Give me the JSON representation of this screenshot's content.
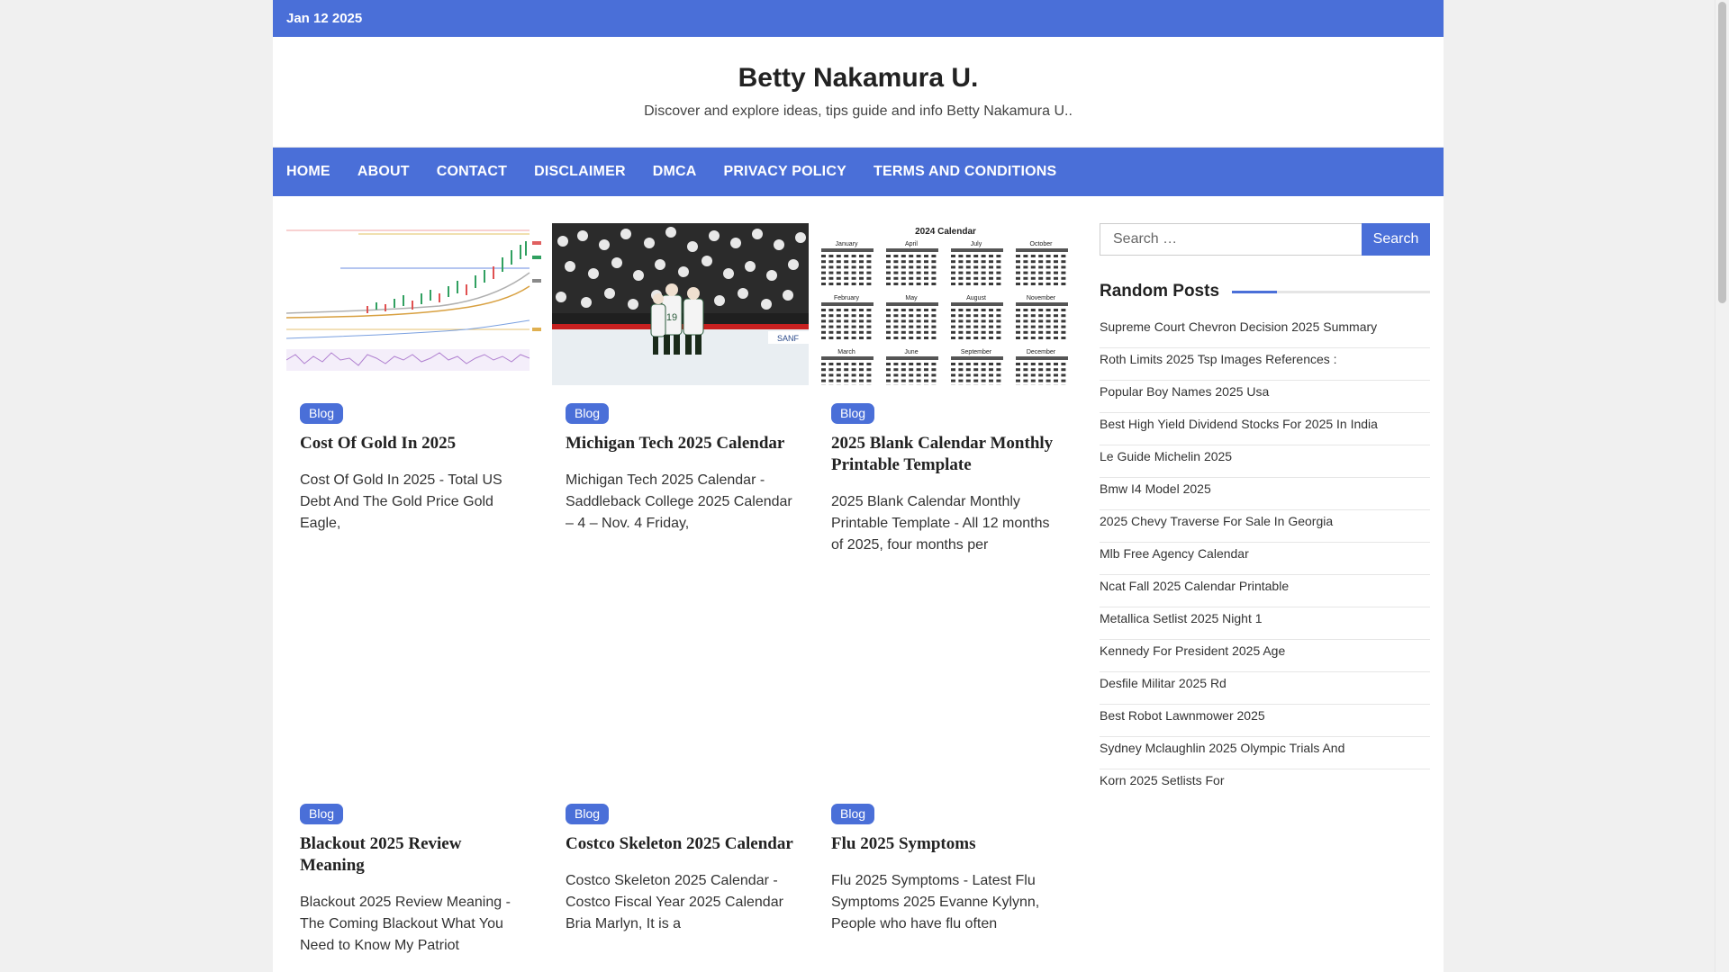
{
  "topbar": {
    "date": "Jan 12 2025"
  },
  "site": {
    "title": "Betty Nakamura U.",
    "tagline": "Discover and explore ideas, tips guide and info Betty Nakamura U.."
  },
  "nav": [
    {
      "label": "HOME"
    },
    {
      "label": "ABOUT"
    },
    {
      "label": "CONTACT"
    },
    {
      "label": "DISCLAIMER"
    },
    {
      "label": "DMCA"
    },
    {
      "label": "PRIVACY POLICY"
    },
    {
      "label": "TERMS AND CONDITIONS"
    }
  ],
  "posts": [
    {
      "category": "Blog",
      "title": "Cost Of Gold In 2025",
      "excerpt": "Cost Of Gold In 2025 - Total US Debt And The Gold Price Gold Eagle,",
      "image": "stock-chart"
    },
    {
      "category": "Blog",
      "title": "Michigan Tech 2025 Calendar",
      "excerpt": "Michigan Tech 2025 Calendar - Saddleback College 2025 Calendar – 4 – Nov. 4 Friday,",
      "image": "hockey-photo"
    },
    {
      "category": "Blog",
      "title": "2025 Blank Calendar Monthly Printable Template",
      "excerpt": "2025 Blank Calendar Monthly Printable Template - All 12 months of 2025, four months per",
      "image": "calendar-grid"
    },
    {
      "category": "Blog",
      "title": "Blackout 2025 Review Meaning",
      "excerpt": "Blackout 2025 Review Meaning - The Coming Blackout What You Need to Know My Patriot"
    },
    {
      "category": "Blog",
      "title": "Costco Skeleton 2025 Calendar",
      "excerpt": "Costco Skeleton 2025 Calendar - Costco Fiscal Year 2025 Calendar Bria Marlyn, It is a"
    },
    {
      "category": "Blog",
      "title": "Flu 2025 Symptoms",
      "excerpt": "Flu 2025 Symptoms - Latest Flu Symptoms 2025 Evanne Kylynn, People who have flu often"
    }
  ],
  "calendar_image": {
    "heading": "2024 Calendar",
    "months": [
      "January",
      "April",
      "July",
      "October",
      "February",
      "May",
      "August",
      "November",
      "March",
      "June",
      "September",
      "December"
    ]
  },
  "sidebar": {
    "search_placeholder": "Search …",
    "search_button": "Search",
    "widget_title": "Random Posts",
    "random_posts": [
      "Supreme Court Chevron Decision 2025 Summary",
      "Roth Limits 2025 Tsp Images References :",
      "Popular Boy Names 2025 Usa",
      "Best High Yield Dividend Stocks For 2025 In India",
      "Le Guide Michelin 2025",
      "Bmw I4 Model 2025",
      "2025 Chevy Traverse For Sale In Georgia",
      "Mlb Free Agency Calendar",
      "Ncat Fall 2025 Calendar Printable",
      "Metallica Setlist 2025 Night 1",
      "Kennedy For President 2025 Age",
      "Desfile Militar 2025 Rd",
      "Best Robot Lawnmower 2025",
      "Sydney Mclaughlin 2025 Olympic Trials And",
      "Korn 2025 Setlists For"
    ]
  },
  "colors": {
    "accent": "#4a6fd8",
    "background": "#f0f0f0"
  }
}
